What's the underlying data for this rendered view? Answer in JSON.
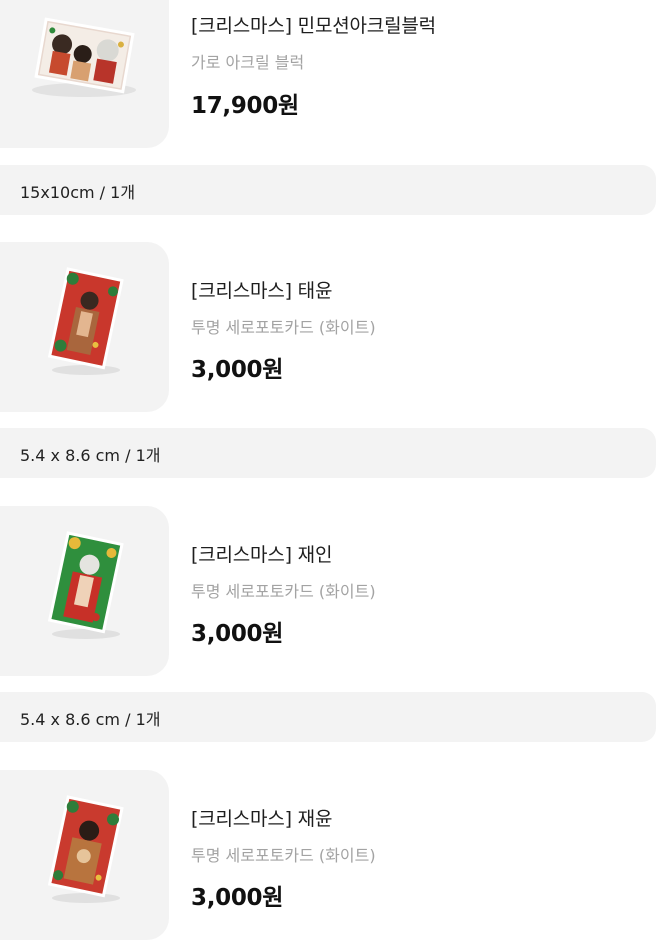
{
  "products": [
    {
      "title": "[크리스마스] 민모션아크릴블럭",
      "subtitle": "가로 아크릴 블럭",
      "price": "17,900원",
      "option": "15x10cm / 1개",
      "image": "acrylic-block-image"
    },
    {
      "title": "[크리스마스] 태윤",
      "subtitle": "투명 세로포토카드 (화이트)",
      "price": "3,000원",
      "option": "5.4 x 8.6 cm / 1개",
      "image": "photocard-taeyun-image"
    },
    {
      "title": "[크리스마스] 재인",
      "subtitle": "투명 세로포토카드 (화이트)",
      "price": "3,000원",
      "option": "5.4 x 8.6 cm / 1개",
      "image": "photocard-jaein-image"
    },
    {
      "title": "[크리스마스] 재윤",
      "subtitle": "투명 세로포토카드 (화이트)",
      "price": "3,000원",
      "image": "photocard-jaeyun-image"
    }
  ],
  "colors": {
    "thumb_bg": "#f3f3f3",
    "option_bg": "#f3f3f3",
    "subtitle": "#a3a3a3",
    "price": "#111111"
  }
}
